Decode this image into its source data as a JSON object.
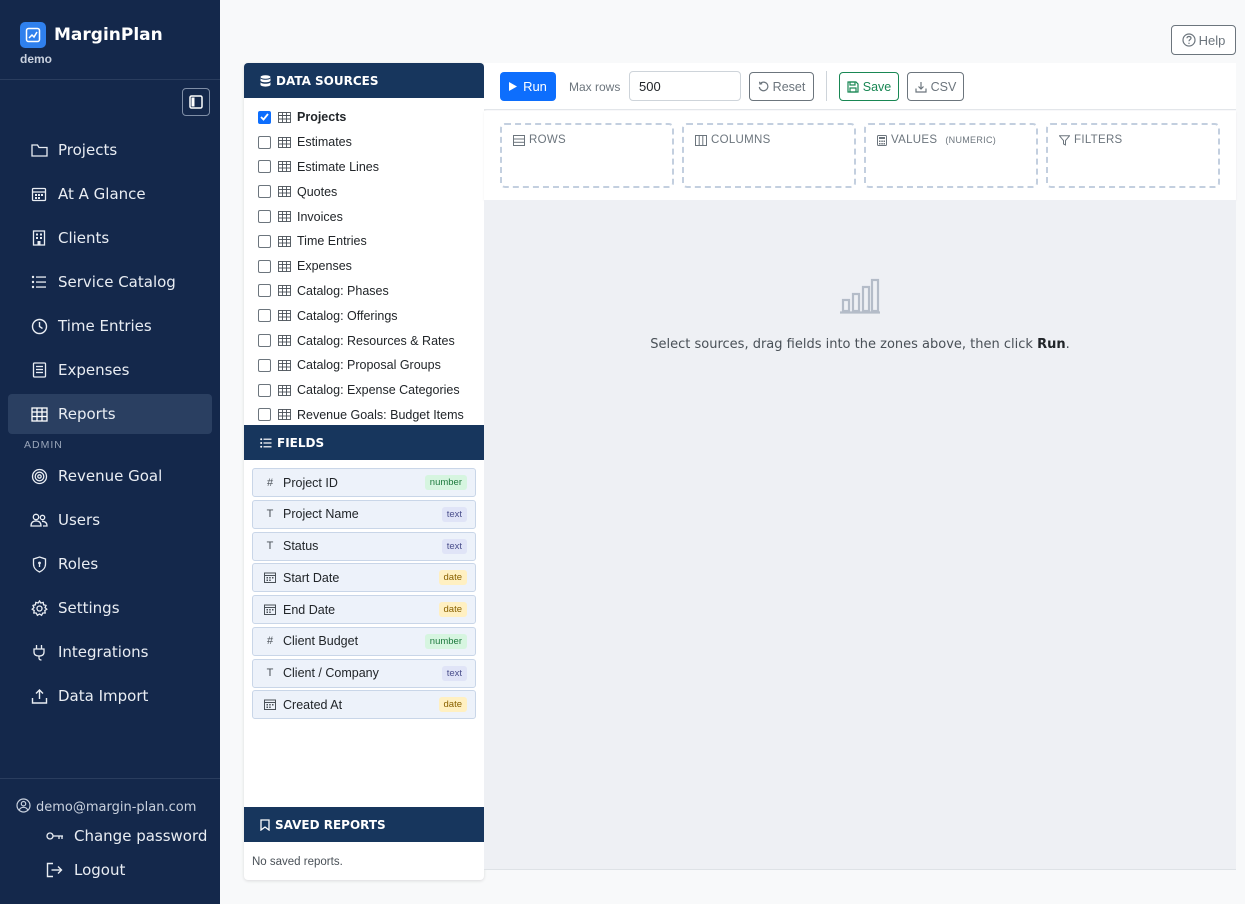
{
  "brand": {
    "name": "MarginPlan",
    "subtitle": "demo"
  },
  "nav": {
    "items": [
      {
        "label": "Projects",
        "icon": "folder-icon"
      },
      {
        "label": "At A Glance",
        "icon": "calendar-icon"
      },
      {
        "label": "Clients",
        "icon": "building-icon"
      },
      {
        "label": "Service Catalog",
        "icon": "list-icon"
      },
      {
        "label": "Time Entries",
        "icon": "clock-icon"
      },
      {
        "label": "Expenses",
        "icon": "receipt-icon"
      },
      {
        "label": "Reports",
        "icon": "table-icon",
        "active": true
      }
    ],
    "admin_label": "ADMIN",
    "admin_items": [
      {
        "label": "Revenue Goal",
        "icon": "target-icon"
      },
      {
        "label": "Users",
        "icon": "users-icon"
      },
      {
        "label": "Roles",
        "icon": "shield-icon"
      },
      {
        "label": "Settings",
        "icon": "gear-icon"
      },
      {
        "label": "Integrations",
        "icon": "plug-icon"
      },
      {
        "label": "Data Import",
        "icon": "upload-icon"
      }
    ]
  },
  "account": {
    "email": "demo@margin-plan.com",
    "change_password": "Change password",
    "logout": "Logout"
  },
  "help_label": "Help",
  "data_sources": {
    "title": "DATA SOURCES",
    "items": [
      {
        "label": "Projects",
        "checked": true
      },
      {
        "label": "Estimates",
        "checked": false
      },
      {
        "label": "Estimate Lines",
        "checked": false
      },
      {
        "label": "Quotes",
        "checked": false
      },
      {
        "label": "Invoices",
        "checked": false
      },
      {
        "label": "Time Entries",
        "checked": false
      },
      {
        "label": "Expenses",
        "checked": false
      },
      {
        "label": "Catalog: Phases",
        "checked": false
      },
      {
        "label": "Catalog: Offerings",
        "checked": false
      },
      {
        "label": "Catalog: Resources & Rates",
        "checked": false
      },
      {
        "label": "Catalog: Proposal Groups",
        "checked": false
      },
      {
        "label": "Catalog: Expense Categories",
        "checked": false
      },
      {
        "label": "Revenue Goals: Budget Items",
        "checked": false
      }
    ]
  },
  "fields": {
    "title": "FIELDS",
    "items": [
      {
        "label": "Project ID",
        "type": "number",
        "icon": "#"
      },
      {
        "label": "Project Name",
        "type": "text",
        "icon": "T"
      },
      {
        "label": "Status",
        "type": "text",
        "icon": "T"
      },
      {
        "label": "Start Date",
        "type": "date",
        "icon": "cal"
      },
      {
        "label": "End Date",
        "type": "date",
        "icon": "cal"
      },
      {
        "label": "Client Budget",
        "type": "number",
        "icon": "#"
      },
      {
        "label": "Client / Company",
        "type": "text",
        "icon": "T"
      },
      {
        "label": "Created At",
        "type": "date",
        "icon": "cal"
      }
    ]
  },
  "saved_reports": {
    "title": "SAVED REPORTS",
    "empty": "No saved reports."
  },
  "toolbar": {
    "run": "Run",
    "max_rows_label": "Max rows",
    "max_rows_value": "500",
    "reset": "Reset",
    "save": "Save",
    "csv": "CSV"
  },
  "zones": {
    "rows": "ROWS",
    "columns": "COLUMNS",
    "values": "VALUES",
    "values_sub": "(NUMERIC)",
    "filters": "FILTERS"
  },
  "empty_state": {
    "text": "Select sources, drag fields into the zones above, then click ",
    "bold": "Run",
    "suffix": "."
  },
  "colors": {
    "sidebar_bg": "#14284b",
    "panel_header": "#17365d",
    "primary": "#0d6efd",
    "save_green": "#198754"
  }
}
